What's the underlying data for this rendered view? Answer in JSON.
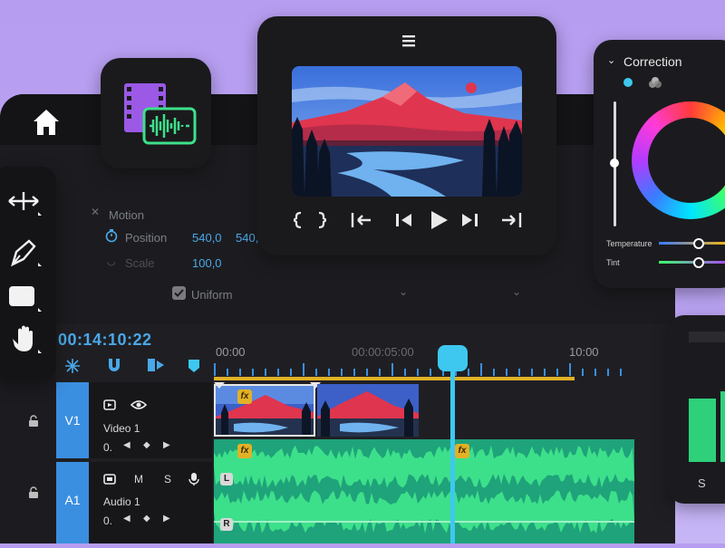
{
  "editor": {
    "home_icon": "home-icon"
  },
  "media_icon": "video-audio-file-icon",
  "preview": {
    "menu_icon": "hamburger-icon",
    "controls": [
      "mark-in-out-icon",
      "step-back-icon",
      "prev-frame-icon",
      "play-icon",
      "next-frame-icon",
      "step-forward-icon"
    ]
  },
  "properties": {
    "motion_label": "Motion",
    "position_label": "Position",
    "position_x": "540,0",
    "position_y": "540,",
    "scale_label": "Scale",
    "scale_value": "100,0",
    "uniform_label": "Uniform"
  },
  "tools": [
    "track-select-icon",
    "pen-icon",
    "rectangle-icon",
    "hand-icon"
  ],
  "timeline": {
    "timecode": "00:14:10:22",
    "ruler": [
      "00:00",
      "00:00:05:00",
      "10:00"
    ],
    "tracks": {
      "video": {
        "id": "V1",
        "name": "Video 1",
        "value": "0."
      },
      "audio": {
        "id": "A1",
        "name": "Audio 1",
        "value": "0.",
        "mute": "M",
        "solo": "S"
      }
    },
    "fx_label": "fx",
    "left_label": "L",
    "right_label": "R"
  },
  "correction": {
    "title": "Correction",
    "sliders": [
      {
        "label": "Temperature"
      },
      {
        "label": "Tint"
      }
    ]
  },
  "meter": {
    "solo_label": "S"
  },
  "colors": {
    "accent": "#3ec8f0",
    "track_blue": "#3b8fe0",
    "audio_green": "#1fa37a",
    "fx_yellow": "#e2b126"
  }
}
